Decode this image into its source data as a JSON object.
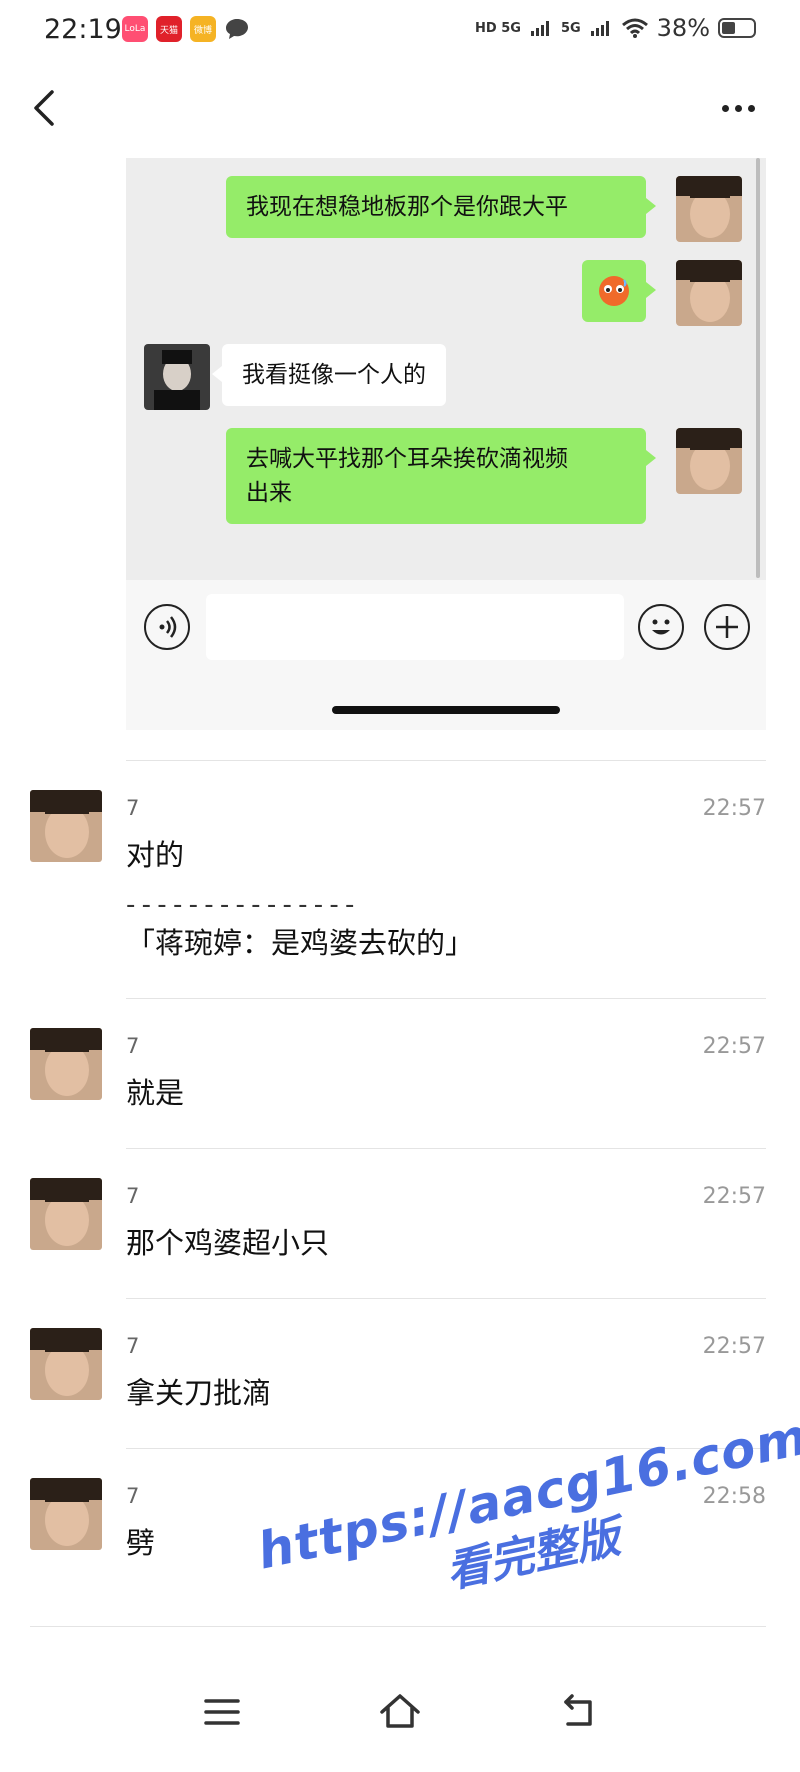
{
  "status_bar": {
    "time": "22:19",
    "apps": [
      {
        "label": "LoLa",
        "color": "#ff4f73"
      },
      {
        "label": "天猫",
        "color": "#e0212a"
      },
      {
        "label": "微博",
        "color": "#f5b324"
      },
      {
        "label": "",
        "color": "#444444"
      }
    ],
    "network_1": "HD 5G",
    "network_2": "5G",
    "battery": "38%"
  },
  "embedded_chat": {
    "messages": [
      {
        "side": "right",
        "text": "我现在想稳地板那个是你跟大平"
      },
      {
        "side": "right",
        "text": "",
        "emoji": "emoji-sticker"
      },
      {
        "side": "left",
        "text": "我看挺像一个人的"
      },
      {
        "side": "right",
        "text": "去喊大平找那个耳朵挨砍滴视频\n出来"
      }
    ]
  },
  "comments": [
    {
      "name": "7",
      "time": "22:57",
      "text": "对的",
      "quote_divider": "- - - - - - - - - - - - - - -",
      "quote": "「蒋琬婷：是鸡婆去砍的」"
    },
    {
      "name": "7",
      "time": "22:57",
      "text": "就是"
    },
    {
      "name": "7",
      "time": "22:57",
      "text": "那个鸡婆超小只"
    },
    {
      "name": "7",
      "time": "22:57",
      "text": "拿关刀批滴"
    },
    {
      "name": "7",
      "time": "22:58",
      "text": "劈"
    }
  ],
  "watermark": {
    "url": "https://aacg16.com",
    "text": "看完整版"
  }
}
